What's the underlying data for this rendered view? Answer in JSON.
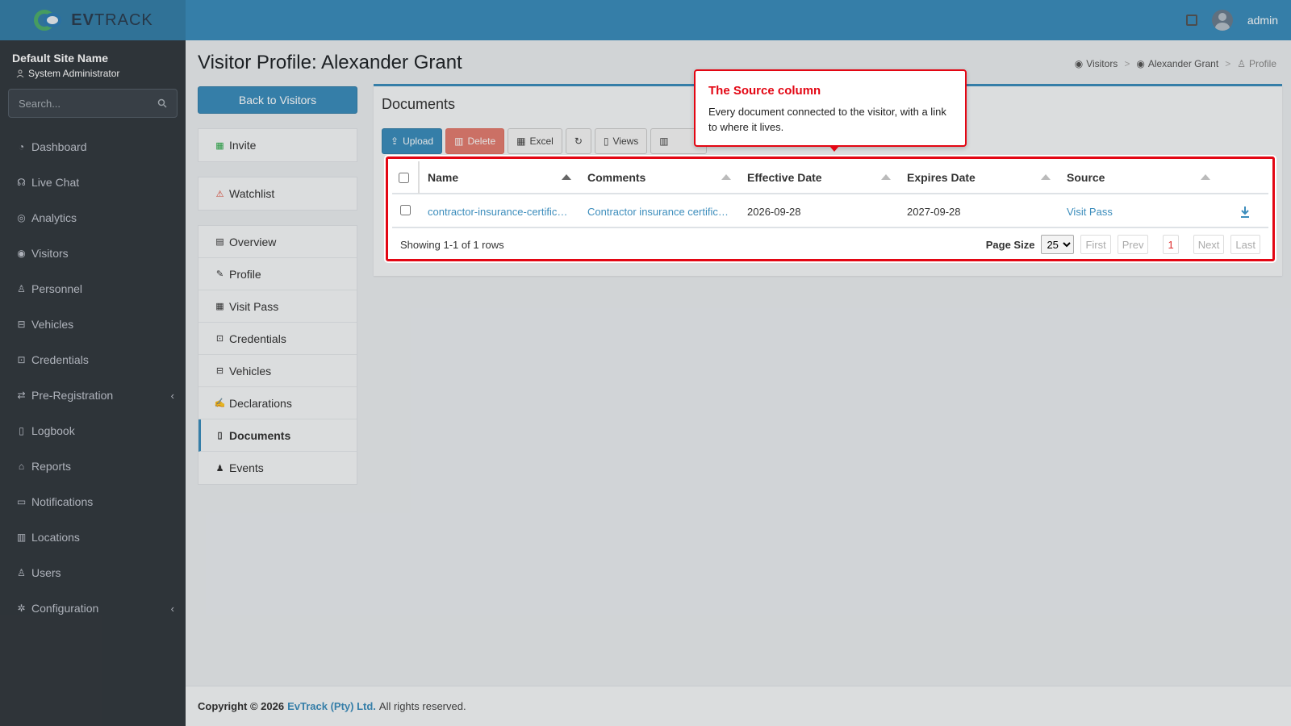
{
  "header": {
    "logo_brand_bold": "EV",
    "logo_brand_rest": "TRACK",
    "user": "admin"
  },
  "sidebar": {
    "site_name": "Default Site Name",
    "role": "System Administrator",
    "search_placeholder": "Search...",
    "items": [
      {
        "label": "Dashboard",
        "icon": "gauge-icon"
      },
      {
        "label": "Live Chat",
        "icon": "headset-icon"
      },
      {
        "label": "Analytics",
        "icon": "target-icon"
      },
      {
        "label": "Visitors",
        "icon": "eye-icon"
      },
      {
        "label": "Personnel",
        "icon": "user-gear-icon"
      },
      {
        "label": "Vehicles",
        "icon": "car-icon"
      },
      {
        "label": "Credentials",
        "icon": "id-badge-icon"
      },
      {
        "label": "Pre-Registration",
        "icon": "arrows-icon"
      },
      {
        "label": "Logbook",
        "icon": "book-icon"
      },
      {
        "label": "Reports",
        "icon": "chart-icon"
      },
      {
        "label": "Notifications",
        "icon": "comments-icon"
      },
      {
        "label": "Locations",
        "icon": "building-icon"
      },
      {
        "label": "Users",
        "icon": "users-gear-icon"
      },
      {
        "label": "Configuration",
        "icon": "cog-icon"
      }
    ]
  },
  "page": {
    "title": "Visitor Profile: Alexander Grant",
    "breadcrumb": [
      "Visitors",
      "Alexander Grant",
      "Profile"
    ],
    "back_button": "Back to Visitors",
    "invite": "Invite",
    "watchlist": "Watchlist",
    "profile_menu": [
      "Overview",
      "Profile",
      "Visit Pass",
      "Credentials",
      "Vehicles",
      "Declarations",
      "Documents",
      "Events"
    ],
    "active_menu": "Documents"
  },
  "documents": {
    "title": "Documents",
    "toolbar": {
      "upload": "Upload",
      "delete": "Delete",
      "excel": "Excel",
      "views": "Views"
    },
    "columns": [
      "Name",
      "Comments",
      "Effective Date",
      "Expires Date",
      "Source"
    ],
    "rows": [
      {
        "name": "contractor-insurance-certific…",
        "comments": "Contractor insurance certific…",
        "effective": "2026-09-28",
        "expires": "2027-09-28",
        "source": "Visit Pass"
      }
    ],
    "showing": "Showing 1-1 of 1 rows",
    "page_size_label": "Page Size",
    "page_size": "25",
    "pager": {
      "first": "First",
      "prev": "Prev",
      "current": "1",
      "next": "Next",
      "last": "Last"
    }
  },
  "callout": {
    "title": "The Source column",
    "body": "Every document connected to the visitor, with a link to where it lives."
  },
  "footer": {
    "prefix": "Copyright © 2026",
    "company": "EvTrack (Pty) Ltd.",
    "suffix": "All rights reserved."
  },
  "colors": {
    "accent": "#3c8dbc",
    "highlight": "#e30613",
    "sidebar": "#343a40"
  }
}
